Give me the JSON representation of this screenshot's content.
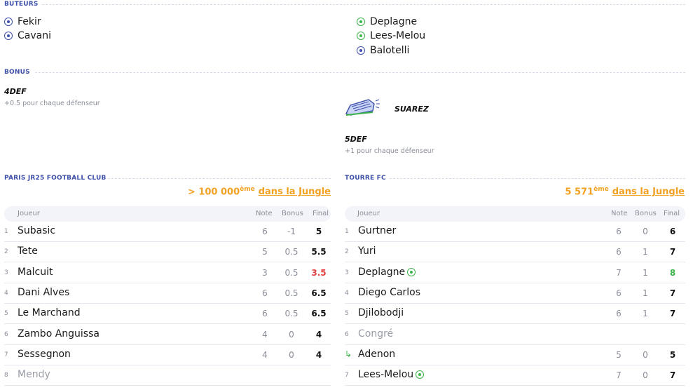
{
  "scorers": {
    "title": "BUTEURS",
    "left": [
      {
        "name": "Fekir",
        "type": "blue"
      },
      {
        "name": "Cavani",
        "type": "blue"
      }
    ],
    "right": [
      {
        "name": "Deplagne",
        "type": "green"
      },
      {
        "name": "Lees-Melou",
        "type": "green"
      },
      {
        "name": "Balotelli",
        "type": "blue"
      }
    ]
  },
  "bonus": {
    "title": "BONUS",
    "left": {
      "name": "4DEF",
      "desc": "+0.5 pour chaque défenseur"
    },
    "right": {
      "shoe_name": "SUAREZ",
      "name": "5DEF",
      "desc": "+1 pour chaque défenseur"
    }
  },
  "teams": {
    "left": {
      "name": "PARIS JR25 FOOTBALL CLUB",
      "rank": "> 100 000",
      "rank_suffix": "ème",
      "rank_link": "dans la Jungle",
      "headers": {
        "player": "Joueur",
        "note": "Note",
        "bonus": "Bonus",
        "final": "Final"
      },
      "rows": [
        {
          "num": "1",
          "name": "Subasic",
          "note": "6",
          "bonus": "-1",
          "final": "5",
          "final_color": "black"
        },
        {
          "num": "2",
          "name": "Tete",
          "note": "5",
          "bonus": "0.5",
          "final": "5.5",
          "final_color": "black"
        },
        {
          "num": "3",
          "name": "Malcuit",
          "note": "3",
          "bonus": "0.5",
          "final": "3.5",
          "final_color": "red"
        },
        {
          "num": "4",
          "name": "Dani Alves",
          "note": "6",
          "bonus": "0.5",
          "final": "6.5",
          "final_color": "black"
        },
        {
          "num": "5",
          "name": "Le Marchand",
          "note": "6",
          "bonus": "0.5",
          "final": "6.5",
          "final_color": "black"
        },
        {
          "num": "6",
          "name": "Zambo Anguissa",
          "note": "4",
          "bonus": "0",
          "final": "4",
          "final_color": "black"
        },
        {
          "num": "7",
          "name": "Sessegnon",
          "note": "4",
          "bonus": "0",
          "final": "4",
          "final_color": "black"
        },
        {
          "num": "8",
          "name": "Mendy",
          "note": "",
          "bonus": "",
          "final": "",
          "final_color": "black",
          "muted": true
        }
      ]
    },
    "right": {
      "name": "TOURRE FC",
      "rank": "5 571",
      "rank_suffix": "ème",
      "rank_link": "dans la Jungle",
      "headers": {
        "player": "Joueur",
        "note": "Note",
        "bonus": "Bonus",
        "final": "Final"
      },
      "rows": [
        {
          "num": "1",
          "name": "Gurtner",
          "note": "6",
          "bonus": "0",
          "final": "6",
          "final_color": "black"
        },
        {
          "num": "2",
          "name": "Yuri",
          "note": "6",
          "bonus": "1",
          "final": "7",
          "final_color": "black"
        },
        {
          "num": "3",
          "name": "Deplagne",
          "note": "7",
          "bonus": "1",
          "final": "8",
          "final_color": "green",
          "goal": true
        },
        {
          "num": "4",
          "name": "Diego Carlos",
          "note": "6",
          "bonus": "1",
          "final": "7",
          "final_color": "black"
        },
        {
          "num": "5",
          "name": "Djilobodji",
          "note": "6",
          "bonus": "1",
          "final": "7",
          "final_color": "black"
        },
        {
          "num": "6",
          "name": "Congré",
          "note": "",
          "bonus": "",
          "final": "",
          "final_color": "black",
          "muted": true
        },
        {
          "num": "",
          "name": "Adenon",
          "note": "5",
          "bonus": "0",
          "final": "5",
          "final_color": "black",
          "sub": true
        },
        {
          "num": "7",
          "name": "Lees-Melou",
          "note": "7",
          "bonus": "0",
          "final": "7",
          "final_color": "black",
          "goal": true
        }
      ]
    }
  },
  "colors": {
    "accent": "#3d4fa8",
    "orange": "#f2a122",
    "green": "#3cb44a",
    "red": "#e34141"
  }
}
